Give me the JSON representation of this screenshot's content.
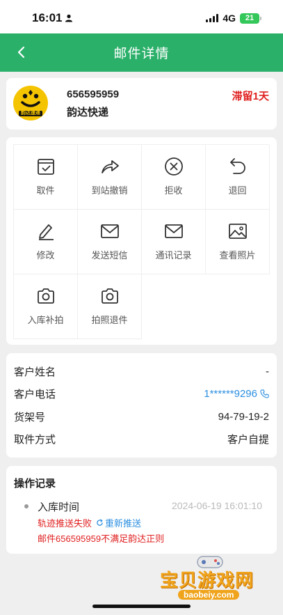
{
  "status_bar": {
    "time": "16:01",
    "network": "4G",
    "battery": "21"
  },
  "header": {
    "title": "邮件详情"
  },
  "company": {
    "logo_text": "韵达速递",
    "tracking_number": "656595959",
    "name": "韵达快递",
    "status": "滞留1天"
  },
  "actions": [
    {
      "label": "取件",
      "icon": "calendar-check-icon"
    },
    {
      "label": "到站撤销",
      "icon": "share-arrow-icon"
    },
    {
      "label": "拒收",
      "icon": "circle-x-icon"
    },
    {
      "label": "退回",
      "icon": "undo-arrow-icon"
    },
    {
      "label": "修改",
      "icon": "pencil-icon"
    },
    {
      "label": "发送短信",
      "icon": "envelope-icon"
    },
    {
      "label": "通讯记录",
      "icon": "envelope-icon"
    },
    {
      "label": "查看照片",
      "icon": "image-icon"
    },
    {
      "label": "入库补拍",
      "icon": "camera-icon"
    },
    {
      "label": "拍照退件",
      "icon": "camera-icon"
    }
  ],
  "info": {
    "customer_name_label": "客户姓名",
    "customer_name_value": "-",
    "customer_phone_label": "客户电话",
    "customer_phone_value": "1******9296",
    "shelf_label": "货架号",
    "shelf_value": "94-79-19-2",
    "pickup_method_label": "取件方式",
    "pickup_method_value": "客户自提"
  },
  "log": {
    "title": "操作记录",
    "event": "入库时间",
    "time": "2024-06-19 16:01:10",
    "push_failed": "轨迹推送失败",
    "repush": "重新推送",
    "rule_error": "邮件656595959不满足韵达正则"
  },
  "watermark": {
    "text": "宝贝游戏网",
    "url": "baobeiy.com"
  },
  "colors": {
    "header_green": "#2bb06a",
    "alert_red": "#e02020",
    "link_blue": "#2d8fe0"
  }
}
